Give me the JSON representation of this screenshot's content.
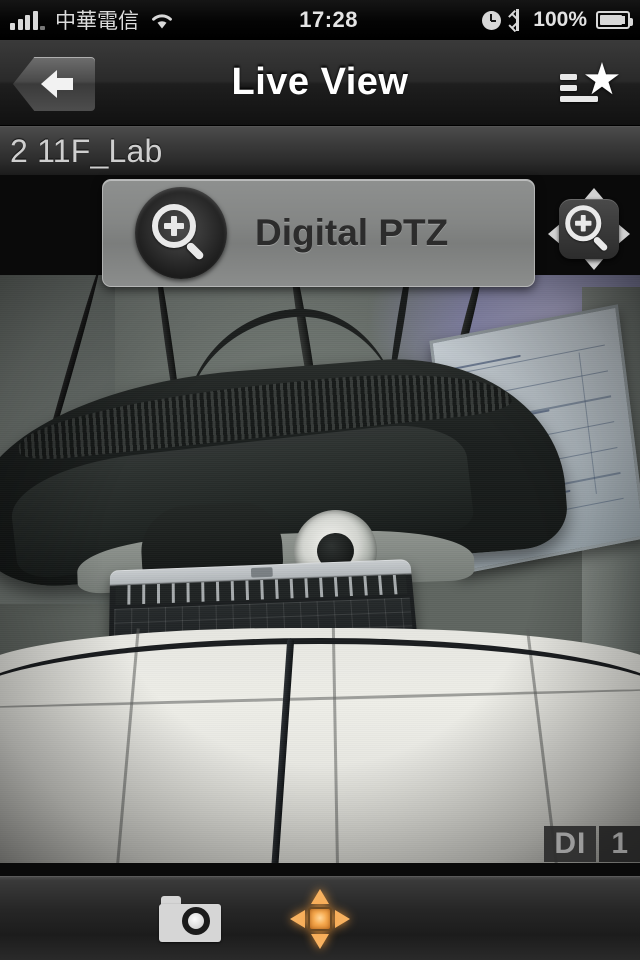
{
  "status_bar": {
    "carrier": "中華電信",
    "time": "17:28",
    "battery_percent": "100%",
    "icons": [
      "signal-bars-icon",
      "wifi-icon",
      "alarm-clock-icon",
      "bluetooth-icon",
      "battery-icon"
    ]
  },
  "nav_bar": {
    "title": "Live View",
    "back_icon": "back-arrow-icon",
    "favorites_icon": "favorites-star-list-icon"
  },
  "camera": {
    "label": "2 11F_Lab"
  },
  "video_overlay": {
    "di_badge": "DI",
    "di_value": "1"
  },
  "toast": {
    "label": "Digital PTZ",
    "icon": "magnifier-plus-icon"
  },
  "ptz_button": {
    "icon": "digital-ptz-zoom-icon",
    "arrows": [
      "up",
      "down",
      "left",
      "right"
    ]
  },
  "toolbar": {
    "snapshot_icon": "camera-snapshot-icon",
    "ptz_icon": "ptz-direction-pad-icon"
  },
  "colors": {
    "accent_orange": "#f7b160",
    "nav_background": "#2a2a2a",
    "toolbar_background": "#262626",
    "text_light": "#cfcfcf"
  }
}
